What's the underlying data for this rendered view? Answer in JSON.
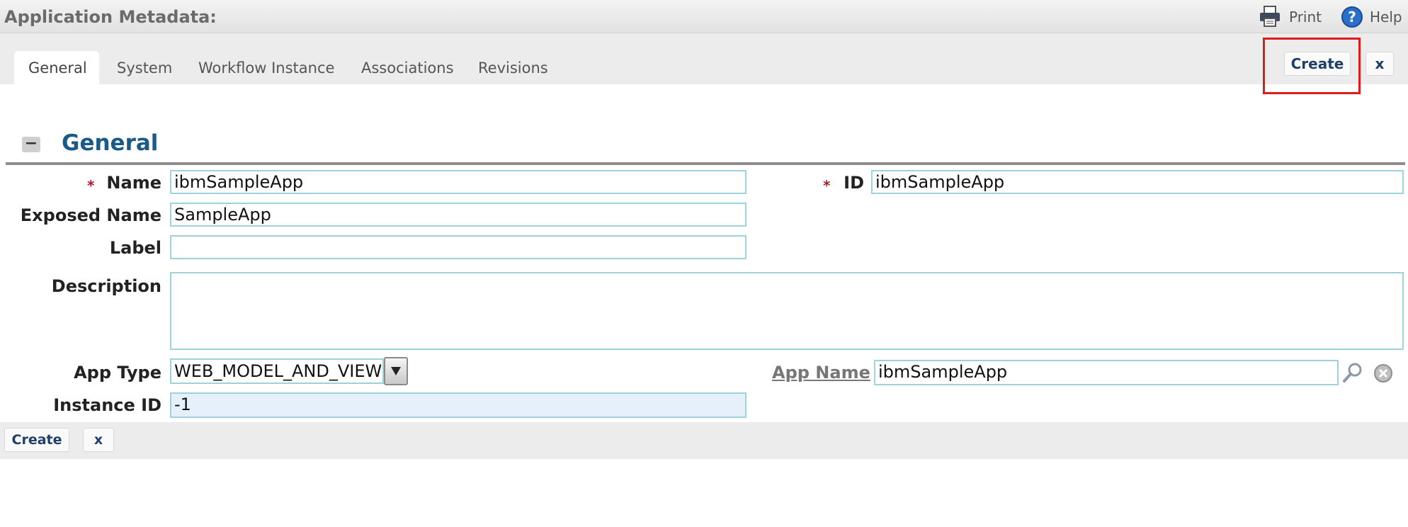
{
  "header": {
    "title": "Application Metadata:",
    "print_label": "Print",
    "help_label": "Help"
  },
  "tabs": [
    {
      "label": "General",
      "active": true
    },
    {
      "label": "System"
    },
    {
      "label": "Workflow Instance"
    },
    {
      "label": "Associations"
    },
    {
      "label": "Revisions"
    }
  ],
  "actions": {
    "create_label": "Create",
    "close_label": "x"
  },
  "section": {
    "toggle_glyph": "−",
    "title": "General"
  },
  "form": {
    "required_marker": "*",
    "name": {
      "label": "Name",
      "value": "ibmSampleApp"
    },
    "id": {
      "label": "ID",
      "value": "ibmSampleApp"
    },
    "exposed_name": {
      "label": "Exposed Name",
      "value": "SampleApp"
    },
    "label": {
      "label": "Label",
      "value": ""
    },
    "description": {
      "label": "Description",
      "value": ""
    },
    "app_type": {
      "label": "App Type",
      "value": "WEB_MODEL_AND_VIEW"
    },
    "app_name": {
      "label": "App Name",
      "value": "ibmSampleApp"
    },
    "instance_id": {
      "label": "Instance ID",
      "value": "-1"
    }
  },
  "footer": {
    "create_label": "Create",
    "close_label": "x"
  },
  "colors": {
    "accent": "#1b5a86",
    "highlight": "#e01b1b",
    "field_border": "#9fd3dc",
    "required": "#b01c2e"
  },
  "icons": [
    "printer-icon",
    "help-icon",
    "search-icon",
    "clear-icon",
    "dropdown-arrow-icon",
    "collapse-icon"
  ]
}
